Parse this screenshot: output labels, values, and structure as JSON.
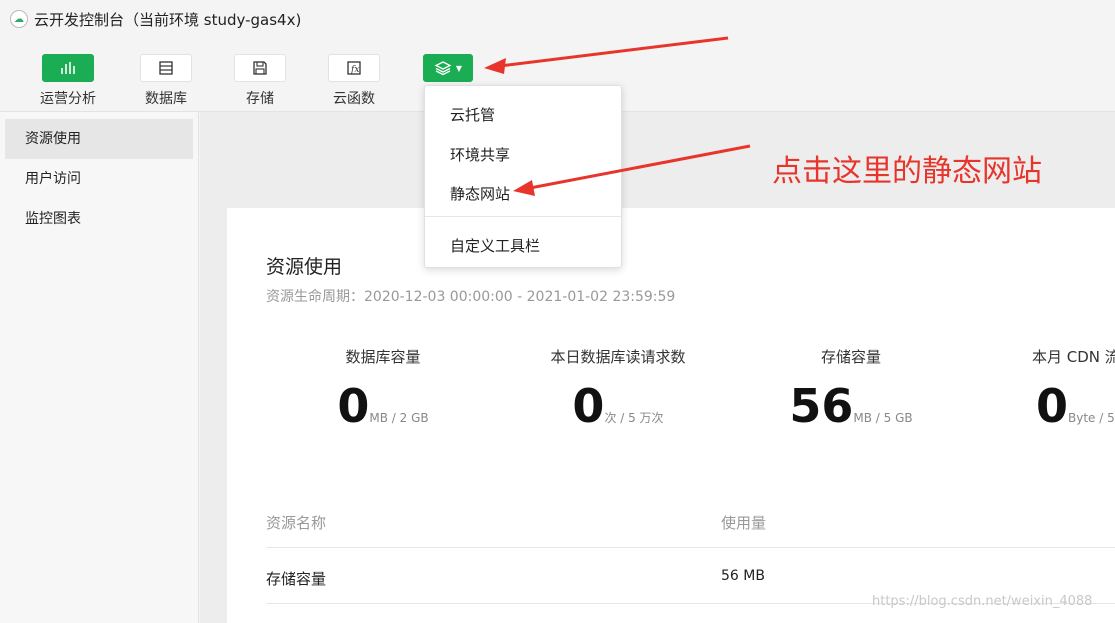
{
  "window": {
    "title": "云开发控制台（当前环境 study-gas4x)"
  },
  "toolbar": {
    "items": [
      {
        "label": "运营分析",
        "icon": "bar-chart-icon"
      },
      {
        "label": "数据库",
        "icon": "database-icon"
      },
      {
        "label": "存储",
        "icon": "save-icon"
      },
      {
        "label": "云函数",
        "icon": "function-icon"
      }
    ],
    "more_icon": "layers-icon",
    "accent": "#1aad53"
  },
  "sidebar": {
    "items": [
      {
        "label": "资源使用"
      },
      {
        "label": "用户访问"
      },
      {
        "label": "监控图表"
      }
    ]
  },
  "dropdown": {
    "items": [
      {
        "label": "云托管"
      },
      {
        "label": "环境共享"
      },
      {
        "label": "静态网站"
      },
      {
        "label": "自定义工具栏"
      }
    ]
  },
  "main": {
    "title": "资源使用",
    "subtitle": "资源生命周期：2020-12-03 00:00:00 - 2021-01-02 23:59:59",
    "metrics": [
      {
        "label": "数据库容量",
        "value": "0",
        "unit": "MB / 2 GB"
      },
      {
        "label": "本日数据库读请求数",
        "value": "0",
        "unit": "次 / 5 万次"
      },
      {
        "label": "存储容量",
        "value": "56",
        "unit": "MB / 5 GB"
      },
      {
        "label": "本月 CDN 流",
        "value": "0",
        "unit": "Byte / 5"
      }
    ],
    "table": {
      "headers": [
        "资源名称",
        "使用量"
      ],
      "rows": [
        {
          "name": "存储容量",
          "usage": "56 MB"
        }
      ]
    }
  },
  "annotation": {
    "text": "点击这里的静态网站",
    "color": "#e8352b"
  },
  "watermark": "https://blog.csdn.net/weixin_4088"
}
